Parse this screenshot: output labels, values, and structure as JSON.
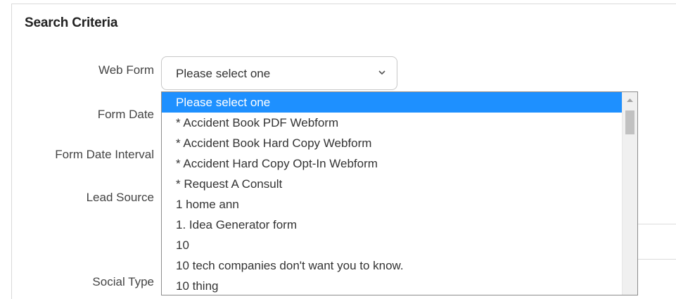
{
  "section_title": "Search Criteria",
  "labels": {
    "web_form": "Web Form",
    "form_date": "Form Date",
    "form_date_interval": "Form Date Interval",
    "lead_source": "Lead Source",
    "social_type": "Social Type"
  },
  "web_form_select": {
    "selected_value": "Please select one",
    "options": [
      "Please select one",
      "* Accident Book PDF Webform",
      "* Accident Book Hard Copy Webform",
      "* Accident Hard Copy Opt-In Webform",
      "* Request A Consult",
      "1 home ann",
      "1. Idea Generator form",
      "10",
      "10 tech companies don't want you to know.",
      "10 thing"
    ],
    "highlighted_index": 0,
    "highlight_color": "#1e90ff"
  },
  "icons": {
    "select_chevron": "chevron-down-icon",
    "scroll_up": "scroll-up-arrow-icon"
  }
}
